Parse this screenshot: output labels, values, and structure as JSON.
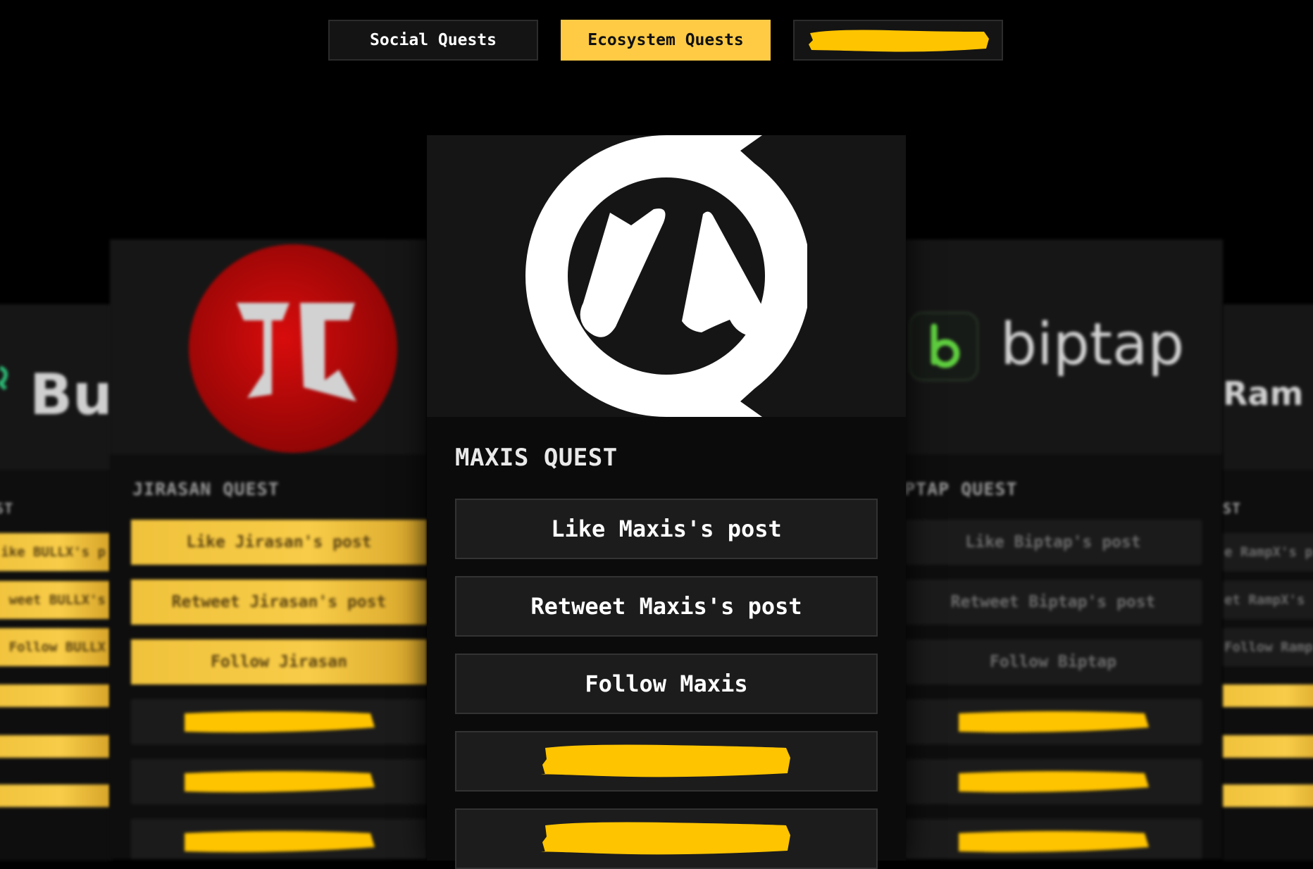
{
  "tabs": {
    "social": "Social Quests",
    "ecosystem": "Ecosystem Quests",
    "active": "Ecosystem Quests"
  },
  "colors": {
    "accent": "#ffcb45",
    "redaction": "#ffc400",
    "background": "#000000",
    "card": "#0b0b0b"
  },
  "cards": {
    "far_left": {
      "brand_fragment": "Bu",
      "title_fragment": "EST",
      "buttons": [
        "ike BULLX's p",
        "weet BULLX's",
        "Follow BULLX"
      ]
    },
    "left": {
      "title": "JIRASAN QUEST",
      "buttons": [
        "Like Jirasan's post",
        "Retweet Jirasan's post",
        "Follow Jirasan"
      ]
    },
    "center": {
      "title": "MAXIS QUEST",
      "buttons": [
        "Like Maxis's post",
        "Retweet Maxis's post",
        "Follow Maxis"
      ]
    },
    "right": {
      "brand": "biptap",
      "title": "PTAP QUEST",
      "buttons": [
        "Like Biptap's post",
        "Retweet Biptap's post",
        "Follow Biptap"
      ]
    },
    "far_right": {
      "brand_fragment": "Ram",
      "title_fragment": "ST",
      "buttons": [
        "e RampX's p",
        "et RampX's",
        "Follow Ramp"
      ]
    }
  }
}
